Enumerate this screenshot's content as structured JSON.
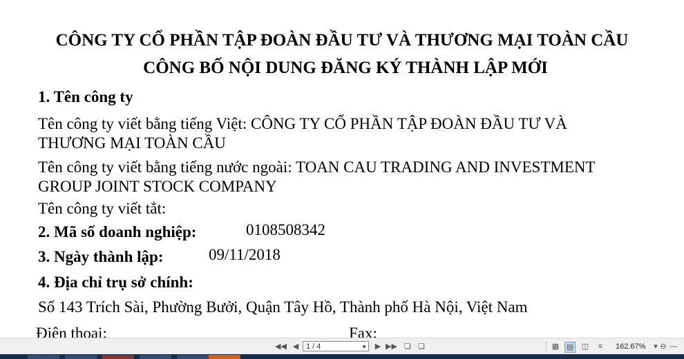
{
  "document": {
    "title_line1": "CÔNG TY CỔ PHẦN TẬP ĐOÀN ĐẦU TƯ VÀ THƯƠNG MẠI TOÀN CẦU",
    "title_line2": "CÔNG BỐ NỘI DUNG ĐĂNG KÝ THÀNH LẬP MỚI",
    "section1_heading": "1. Tên công ty",
    "name_vi_line1": "Tên công ty viết bằng tiếng Việt: CÔNG TY CỔ PHẦN TẬP ĐOÀN ĐẦU TƯ VÀ",
    "name_vi_line2": "THƯƠNG MẠI TOÀN CẦU",
    "name_foreign_line1": "Tên công ty viết bằng tiếng nước ngoài: TOAN CAU TRADING AND INVESTMENT",
    "name_foreign_line2": "GROUP JOINT STOCK COMPANY",
    "name_short": "Tên công ty viết tắt:",
    "section2_heading": "2. Mã số doanh nghiệp:",
    "business_code": "0108508342",
    "section3_heading": "3. Ngày thành lập:",
    "founding_date": "09/11/2018",
    "section4_heading": "4. Địa chỉ trụ sở chính:",
    "address": "Số 143 Trích Sài, Phường Bưởi, Quận Tây Hồ, Thành phố Hà Nội, Việt Nam",
    "phone_label": "Điện thoại:",
    "fax_label": "Fax:"
  },
  "toolbar": {
    "page_indicator": "1 / 4",
    "zoom_level": "162.67%",
    "icons": {
      "first": "first-page-icon",
      "prev": "prev-page-icon",
      "next": "next-page-icon",
      "last": "last-page-icon",
      "zoom_out": "zoom-out-icon"
    }
  }
}
